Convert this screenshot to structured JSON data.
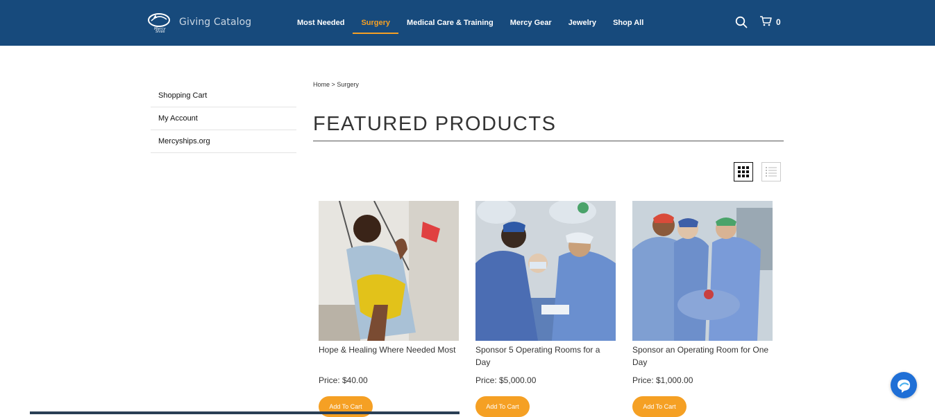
{
  "header": {
    "brand_mark": "Mercy Ships",
    "brand_text": "Giving Catalog",
    "nav": [
      {
        "label": "Most Needed"
      },
      {
        "label": "Surgery"
      },
      {
        "label": "Medical Care & Training"
      },
      {
        "label": "Mercy Gear"
      },
      {
        "label": "Jewelry"
      },
      {
        "label": "Shop All"
      }
    ],
    "active_nav": "Surgery",
    "cart_count": "0",
    "accent": "#f5a024",
    "bar_color": "#174a7c"
  },
  "sidebar": {
    "links": [
      {
        "label": "Shopping Cart"
      },
      {
        "label": "My Account"
      },
      {
        "label": "Mercyships.org"
      }
    ]
  },
  "breadcrumb": {
    "home": "Home",
    "separator": ">",
    "current": "Surgery"
  },
  "main": {
    "title": "FEATURED PRODUCTS",
    "view_modes": [
      "grid",
      "list"
    ],
    "selected_view": "grid"
  },
  "products": [
    {
      "name": "Hope & Healing Where Needed Most",
      "price": "Price: $40.00",
      "button": "Add To Cart"
    },
    {
      "name": "Sponsor 5 Operating Rooms for a Day",
      "price": "Price: $5,000.00",
      "button": "Add To Cart"
    },
    {
      "name": "Sponsor an Operating Room for One Day",
      "price": "Price: $1,000.00",
      "button": "Add To Cart"
    }
  ]
}
